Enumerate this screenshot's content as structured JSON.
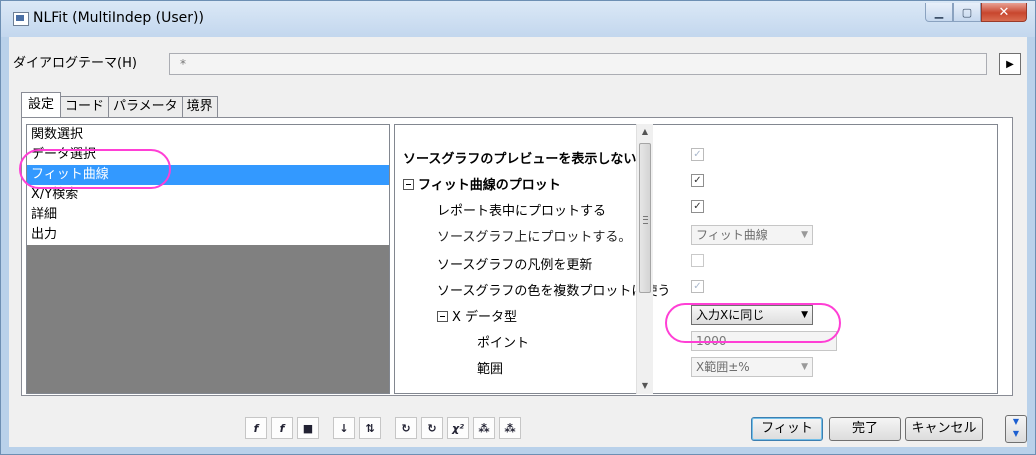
{
  "window": {
    "title": "NLFit (MultiIndep (User))"
  },
  "theme": {
    "label": "ダイアログテーマ(H)",
    "value": "*"
  },
  "tabs": [
    "設定",
    "コード",
    "パラメータ",
    "境界"
  ],
  "nav": {
    "items": [
      "関数選択",
      "データ選択",
      "フィット曲線",
      "X/Y検索",
      "詳細",
      "出力"
    ],
    "selected_index": 2
  },
  "props": {
    "no_preview": {
      "label": "ソースグラフのプレビューを表示しない",
      "checked": true
    },
    "plot_fit": {
      "label": "フィット曲線のプロット",
      "checked": true
    },
    "plot_report": {
      "label": "レポート表中にプロットする",
      "checked": true
    },
    "plot_source": {
      "label": "ソースグラフ上にプロットする。",
      "value": "フィット曲線"
    },
    "update_legend": {
      "label": "ソースグラフの凡例を更新",
      "checked": false
    },
    "use_color": {
      "label": "ソースグラフの色を複数プロットに使う",
      "checked": true
    },
    "x_type": {
      "label": "X データ型",
      "value": "入力Xに同じ"
    },
    "points": {
      "label": "ポイント",
      "value": "1000"
    },
    "range": {
      "label": "範囲",
      "value": "X範囲±%"
    }
  },
  "toolbar": {
    "icons": [
      "f(x)",
      "f",
      "save",
      "sort",
      "sort-2",
      "1 iter",
      "iter",
      "χ²",
      "fit-1",
      "fit-all"
    ]
  },
  "buttons": {
    "fit": "フィット",
    "done": "完了",
    "cancel": "キャンセル"
  }
}
